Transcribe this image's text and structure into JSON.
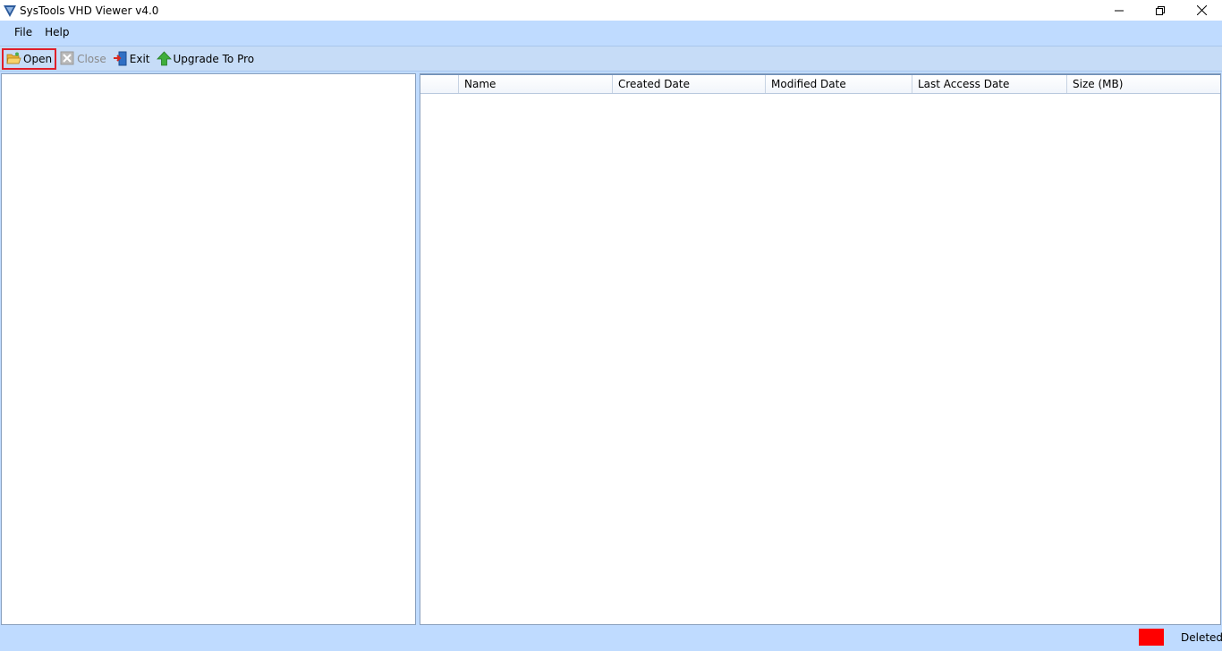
{
  "window": {
    "title": "SysTools VHD Viewer v4.0",
    "controls": {
      "minimize": "—",
      "restore": "❐",
      "close": "✕"
    }
  },
  "menu": {
    "items": [
      "File",
      "Help"
    ]
  },
  "toolbar": {
    "open": "Open",
    "close": "Close",
    "exit": "Exit",
    "upgrade": "Upgrade To Pro"
  },
  "grid": {
    "columns": [
      "",
      "Name",
      "Created Date",
      "Modified Date",
      "Last Access Date",
      "Size (MB)"
    ],
    "rows": []
  },
  "status": {
    "legend": [
      {
        "label": "Deleted",
        "color": "#ff0000"
      }
    ]
  }
}
